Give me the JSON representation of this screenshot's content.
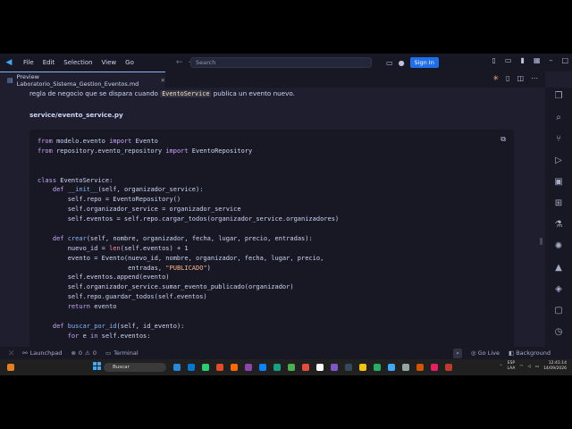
{
  "menu": {
    "items": [
      "File",
      "Edit",
      "Selection",
      "View",
      "Go"
    ],
    "search_placeholder": "Search",
    "signin_label": "Sign In"
  },
  "tab": {
    "title": "Preview Laboratorio_Sistema_Gestion_Eventos.md"
  },
  "doc": {
    "paragraph_before": "regla de negocio que se dispara cuando ",
    "paragraph_code": "EventoService",
    "paragraph_after": " publica un evento nuevo.",
    "file_heading": "service/evento_service.py",
    "code_lines": [
      [
        {
          "t": "from",
          "c": "kw"
        },
        {
          "t": " modelo.evento "
        },
        {
          "t": "import",
          "c": "kw"
        },
        {
          "t": " Evento"
        }
      ],
      [
        {
          "t": "from",
          "c": "kw"
        },
        {
          "t": " repository.evento_repository "
        },
        {
          "t": "import",
          "c": "kw"
        },
        {
          "t": " EventoRepository"
        }
      ],
      [],
      [],
      [
        {
          "t": "class",
          "c": "kw"
        },
        {
          "t": " EventoService:"
        }
      ],
      [
        {
          "t": "    "
        },
        {
          "t": "def",
          "c": "kw"
        },
        {
          "t": " "
        },
        {
          "t": "__init__",
          "c": "fn"
        },
        {
          "t": "(self, organizador_service):"
        }
      ],
      [
        {
          "t": "        self.repo = EventoRepository()"
        }
      ],
      [
        {
          "t": "        self.organizador_service = organizador_service"
        }
      ],
      [
        {
          "t": "        self.eventos = self.repo.cargar_todos(organizador_service.organizadores)"
        }
      ],
      [],
      [
        {
          "t": "    "
        },
        {
          "t": "def",
          "c": "kw"
        },
        {
          "t": " "
        },
        {
          "t": "crear",
          "c": "fn"
        },
        {
          "t": "(self, nombre, organizador, fecha, lugar, precio, entradas):"
        }
      ],
      [
        {
          "t": "        nuevo_id = "
        },
        {
          "t": "len",
          "c": "bi"
        },
        {
          "t": "(self.eventos) + 1"
        }
      ],
      [
        {
          "t": "        evento = Evento(nuevo_id, nombre, organizador, fecha, lugar, precio,"
        }
      ],
      [
        {
          "t": "                        entradas, "
        },
        {
          "t": "\"PUBLICADO\"",
          "c": "str"
        },
        {
          "t": ")"
        }
      ],
      [
        {
          "t": "        self.eventos.append(evento)"
        }
      ],
      [
        {
          "t": "        self.organizador_service.sumar_evento_publicado(organizador)"
        }
      ],
      [
        {
          "t": "        self.repo.guardar_todos(self.eventos)"
        }
      ],
      [
        {
          "t": "        "
        },
        {
          "t": "return",
          "c": "kw"
        },
        {
          "t": " evento"
        }
      ],
      [],
      [
        {
          "t": "    "
        },
        {
          "t": "def",
          "c": "kw"
        },
        {
          "t": " "
        },
        {
          "t": "buscar_por_id",
          "c": "fn"
        },
        {
          "t": "(self, id_evento):"
        }
      ],
      [
        {
          "t": "        "
        },
        {
          "t": "for",
          "c": "kw"
        },
        {
          "t": " e "
        },
        {
          "t": "in",
          "c": "kw"
        },
        {
          "t": " self.eventos:"
        }
      ]
    ]
  },
  "status": {
    "launchpad": "Launchpad",
    "errors": "0",
    "warnings": "0",
    "terminal": "Terminal",
    "go_live": "Go Live",
    "background": "Background"
  },
  "taskbar": {
    "search_placeholder": "Buscar",
    "lang_top": "ESP",
    "lang_bottom": "LAA",
    "time": "12:41:14",
    "date": "14/09/2026"
  }
}
